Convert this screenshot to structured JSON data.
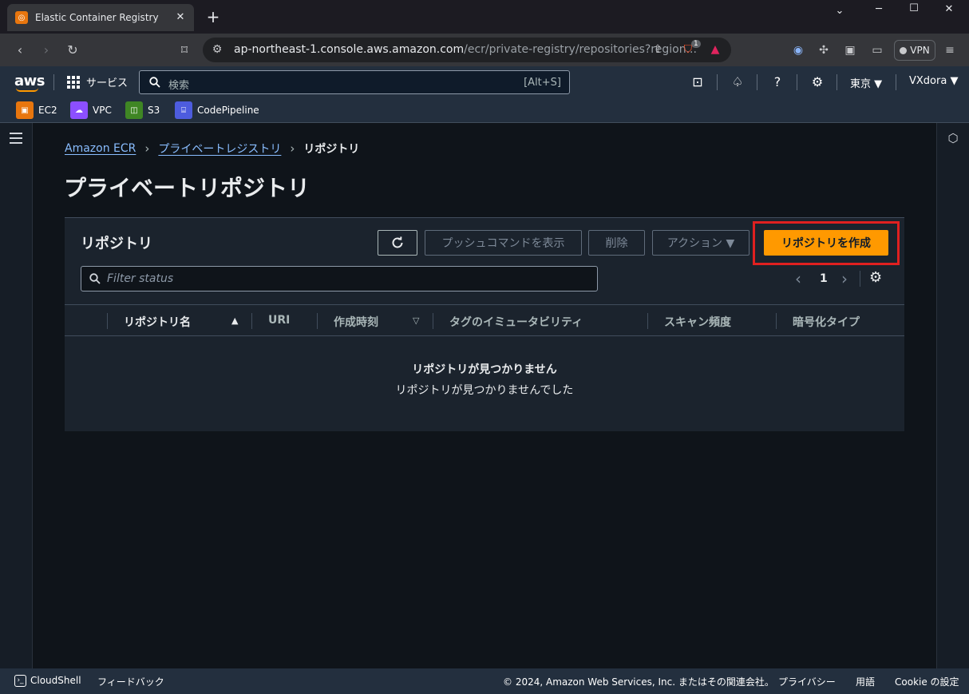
{
  "browser": {
    "tab_title": "Elastic Container Registry",
    "tab_close": "✕",
    "new_tab": "+",
    "url_host": "ap-northeast-1.console.aws.amazon.com",
    "url_path": "/ecr/private-registry/repositories?region...",
    "shield_badge": "1",
    "vpn_label": "VPN"
  },
  "aws_header": {
    "logo": "aws",
    "services_label": "サービス",
    "search_placeholder": "検索",
    "search_shortcut": "[Alt+S]",
    "region": "東京 ▼",
    "account": "VXdora ▼"
  },
  "favorites": [
    {
      "label": "EC2",
      "color": "#e8760e"
    },
    {
      "label": "VPC",
      "color": "#8c4fff"
    },
    {
      "label": "S3",
      "color": "#3f8624"
    },
    {
      "label": "CodePipeline",
      "color": "#4d5cde"
    }
  ],
  "breadcrumb": {
    "item1": "Amazon ECR",
    "item2": "プライベートレジストリ",
    "current": "リポジトリ",
    "sep": "›"
  },
  "page_title": "プライベートリポジトリ",
  "panel": {
    "title": "リポジトリ",
    "buttons": {
      "push_commands": "プッシュコマンドを表示",
      "delete": "削除",
      "actions": "アクション ▼",
      "create": "リポジトリを作成"
    },
    "filter_placeholder": "Filter status",
    "pagination": {
      "prev": "‹",
      "page": "1",
      "next": "›"
    },
    "columns": {
      "name": "リポジトリ名",
      "uri": "URI",
      "created": "作成時刻",
      "tag_immutability": "タグのイミュータビリティ",
      "scan_frequency": "スキャン頻度",
      "encryption": "暗号化タイプ"
    },
    "empty_title": "リポジトリが見つかりません",
    "empty_message": "リポジトリが見つかりませんでした"
  },
  "footer": {
    "cloudshell": "CloudShell",
    "feedback": "フィードバック",
    "copyright": "© 2024, Amazon Web Services, Inc. またはその関連会社。",
    "privacy": "プライバシー",
    "terms": "用語",
    "cookie": "Cookie の設定"
  },
  "colors": {
    "accent": "#ff9900",
    "link": "#89bdff",
    "highlight_box": "#e02020"
  }
}
